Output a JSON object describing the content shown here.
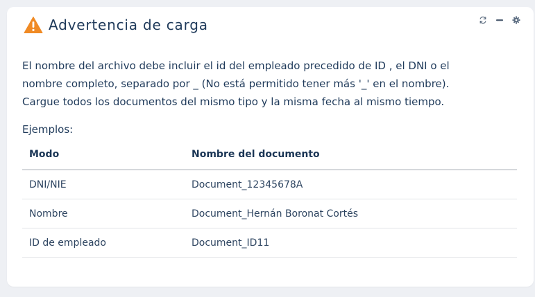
{
  "card": {
    "title": "Advertencia de carga",
    "icon": "warning-icon",
    "controls": [
      "refresh-icon",
      "minimize-icon",
      "gear-icon"
    ]
  },
  "message": {
    "line1": "El nombre del archivo debe incluir el id del empleado precedido de ID , el DNI o el",
    "line2": "nombre completo, separado por _ (No está permitido tener más '_' en el nombre).",
    "line3": "Cargue todos los documentos del mismo tipo y la misma fecha al mismo tiempo."
  },
  "examples": {
    "label": "Ejemplos:",
    "headers": [
      "Modo",
      "Nombre del documento"
    ],
    "rows": [
      [
        "DNI/NIE",
        "Document_12345678A"
      ],
      [
        "Nombre",
        "Document_Hernán Boronat Cortés"
      ],
      [
        "ID de empleado",
        "Document_ID11"
      ]
    ]
  },
  "colors": {
    "warning": "#f08a24",
    "text": "#1f3a5a",
    "icon": "#5f6f82"
  }
}
